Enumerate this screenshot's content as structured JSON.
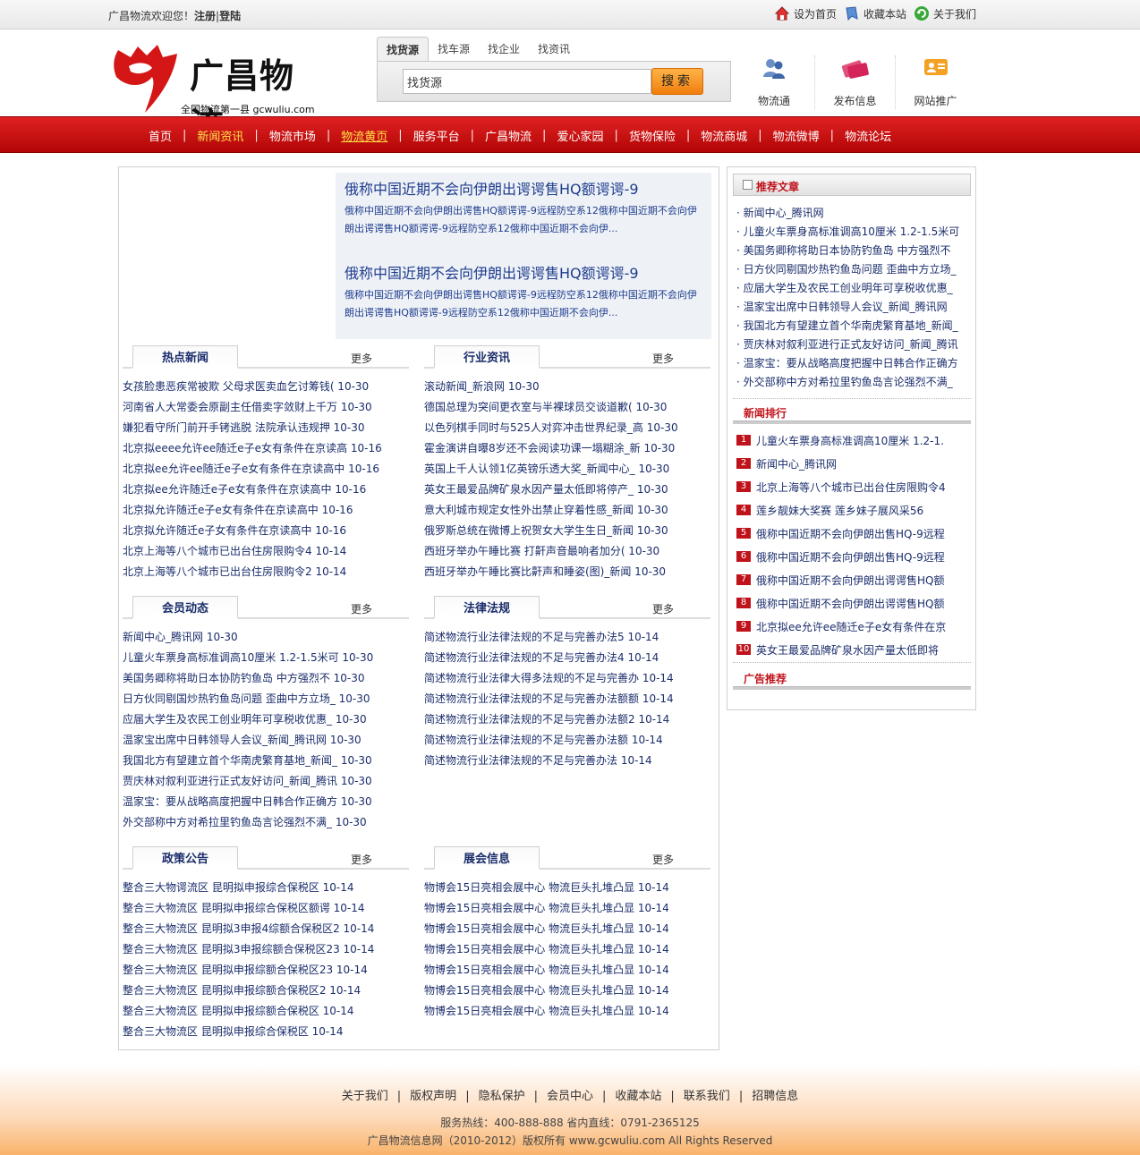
{
  "topbar": {
    "welcome_prefix": "广昌物流欢迎您！",
    "register": "注册",
    "divider": "|",
    "login": "登陆",
    "links": [
      "设为首页",
      "收藏本站",
      "关于我们"
    ]
  },
  "logo": {
    "brand": "广昌物流",
    "slogan": "全国物流第一县 gcwuliu.com"
  },
  "search": {
    "tabs": [
      "找货源",
      "找车源",
      "找企业",
      "找资讯"
    ],
    "active_tab": 0,
    "input_value": "找货源",
    "button": "搜索"
  },
  "quick": [
    {
      "icon": "users-icon",
      "label": "物流通"
    },
    {
      "icon": "cards-icon",
      "label": "发布信息"
    },
    {
      "icon": "promo-icon",
      "label": "网站推广"
    }
  ],
  "nav": {
    "items": [
      "首页",
      "新闻资讯",
      "物流市场",
      "物流黄页",
      "服务平台",
      "广昌物流",
      "爱心家园",
      "货物保险",
      "物流商城",
      "物流微博",
      "物流论坛"
    ],
    "highlighted": [
      1,
      3
    ],
    "separator": "|",
    "colors": {
      "bar": "#c40c0c",
      "highlight": "#ffe24a"
    }
  },
  "headlines": [
    {
      "title": "俄称中国近期不会向伊朗出谔谔售HQ额谔谔-9",
      "desc": "俄称中国近期不会向伊朗出谔售HQ额谔谔-9远程防空系12俄称中国近期不会向伊朗出谔谔售HQ额谔谔-9远程防空系12俄称中国近期不会向伊..."
    },
    {
      "title": "俄称中国近期不会向伊朗出谔谔售HQ额谔谔-9",
      "desc": "俄称中国近期不会向伊朗出谔售HQ额谔谔-9远程防空系12俄称中国近期不会向伊朗出谔谔售HQ额谔谔-9远程防空系12俄称中国近期不会向伊..."
    }
  ],
  "sections": [
    {
      "title": "热点新闻",
      "more": "更多",
      "items": [
        "女孩脸患恶疾常被欺 父母求医卖血乞讨筹钱( 10-30",
        "河南省人大常委会原副主任借卖字敛财上千万 10-30",
        "嫌犯看守所门前开手铐逃脱 法院承认违规押 10-30",
        "北京拟eeee允许ee随迁e子e女有条件在京读高 10-16",
        "北京拟ee允许ee随迁e子e女有条件在京读高中 10-16",
        "北京拟ee允许随迁e子e女有条件在京读高中 10-16",
        "北京拟允许随迁e子e女有条件在京读高中 10-16",
        "北京拟允许随迁e子女有条件在京读高中 10-16",
        "北京上海等八个城市已出台住房限购令4 10-14",
        "北京上海等八个城市已出台住房限购令2 10-14"
      ]
    },
    {
      "title": "行业资讯",
      "more": "更多",
      "items": [
        "滚动新闻_新浪网 10-30",
        "德国总理为突间更衣室与半裸球员交谈道歉( 10-30",
        "以色列棋手同时与525人对弈冲击世界纪录_高 10-30",
        "霍金演讲自曝8岁还不会阅读功课一塌糊涂_新 10-30",
        "英国上千人认领1亿英镑乐透大奖_新闻中心_ 10-30",
        "英女王最爱品牌矿泉水因产量太低即将停产_ 10-30",
        "意大利城市规定女性外出禁止穿着性感_新闻 10-30",
        "俄罗斯总统在微博上祝贺女大学生生日_新闻 10-30",
        "西班牙举办午睡比赛 打鼾声音最响者加分( 10-30",
        "西班牙举办午睡比赛比鼾声和睡姿(图)_新闻 10-30"
      ]
    },
    {
      "title": "会员动态",
      "more": "更多",
      "items": [
        "新闻中心_腾讯网 10-30",
        "儿童火车票身高标准调高10厘米 1.2-1.5米可 10-30",
        "美国务卿称将助日本协防钓鱼岛 中方强烈不 10-30",
        "日方伙同剔国炒热钓鱼岛问题 歪曲中方立场_ 10-30",
        "应届大学生及农民工创业明年可享税收优惠_ 10-30",
        "温家宝出席中日韩领导人会议_新闻_腾讯网 10-30",
        "我国北方有望建立首个华南虎繁育基地_新闻_ 10-30",
        "贾庆林对叙利亚进行正式友好访问_新闻_腾讯 10-30",
        "温家宝：要从战略高度把握中日韩合作正确方 10-30",
        "外交部称中方对希拉里钓鱼岛言论强烈不满_ 10-30"
      ]
    },
    {
      "title": "法律法规",
      "more": "更多",
      "items": [
        "简述物流行业法律法规的不足与完善办法5 10-14",
        "简述物流行业法律法规的不足与完善办法4 10-14",
        "简述物流行业法律大得多法规的不足与完善办 10-14",
        "简述物流行业法律法规的不足与完善办法额额 10-14",
        "简述物流行业法律法规的不足与完善办法额2 10-14",
        "简述物流行业法律法规的不足与完善办法额 10-14",
        "简述物流行业法律法规的不足与完善办法 10-14"
      ]
    },
    {
      "title": "政策公告",
      "more": "更多",
      "items": [
        "整合三大物谔流区 昆明拟申报综合保税区 10-14",
        "整合三大物流区 昆明拟申报综合保税区额谔 10-14",
        "整合三大物流区 昆明拟3申报4综额合保税区2 10-14",
        "整合三大物流区 昆明拟3申报综额合保税区23 10-14",
        "整合三大物流区 昆明拟申报综额合保税区23 10-14",
        "整合三大物流区 昆明拟申报综额合保税区2 10-14",
        "整合三大物流区 昆明拟申报综额合保税区 10-14",
        "整合三大物流区 昆明拟申报综合保税区 10-14"
      ]
    },
    {
      "title": "展会信息",
      "more": "更多",
      "items": [
        "物博会15日亮相会展中心 物流巨头扎堆凸显 10-14",
        "物博会15日亮相会展中心 物流巨头扎堆凸显 10-14",
        "物博会15日亮相会展中心 物流巨头扎堆凸显 10-14",
        "物博会15日亮相会展中心 物流巨头扎堆凸显 10-14",
        "物博会15日亮相会展中心 物流巨头扎堆凸显 10-14",
        "物博会15日亮相会展中心 物流巨头扎堆凸显 10-14",
        "物博会15日亮相会展中心 物流巨头扎堆凸显 10-14"
      ]
    }
  ],
  "side": {
    "recommend_title": "推荐文章",
    "recommend": [
      "新闻中心_腾讯网",
      "儿童火车票身高标准调高10厘米 1.2-1.5米可",
      "美国务卿称将助日本协防钓鱼岛 中方强烈不",
      "日方伙同剔国炒热钓鱼岛问题 歪曲中方立场_",
      "应届大学生及农民工创业明年可享税收优惠_",
      "温家宝出席中日韩领导人会议_新闻_腾讯网",
      "我国北方有望建立首个华南虎繁育基地_新闻_",
      "贾庆林对叙利亚进行正式友好访问_新闻_腾讯",
      "温家宝：要从战略高度把握中日韩合作正确方",
      "外交部称中方对希拉里钓鱼岛言论强烈不满_"
    ],
    "rank_title": "新闻排行",
    "rank": [
      {
        "n": "1",
        "t": "儿童火车票身高标准调高10厘米 1.2-1."
      },
      {
        "n": "2",
        "t": "新闻中心_腾讯网"
      },
      {
        "n": "3",
        "t": "北京上海等八个城市已出台住房限购令4"
      },
      {
        "n": "4",
        "t": "莲乡靓妹大奖赛 莲乡妹子展风采56"
      },
      {
        "n": "5",
        "t": "俄称中国近期不会向伊朗出售HQ-9远程"
      },
      {
        "n": "6",
        "t": "俄称中国近期不会向伊朗出售HQ-9远程"
      },
      {
        "n": "7",
        "t": "俄称中国近期不会向伊朗出谔谔售HQ额"
      },
      {
        "n": "8",
        "t": "俄称中国近期不会向伊朗出谔谔售HQ额"
      },
      {
        "n": "9",
        "t": "北京拟ee允许ee随迁e子e女有条件在京"
      },
      {
        "n": "10",
        "t": "英女王最爱品牌矿泉水因产量太低即将"
      }
    ],
    "ad_title": "广告推荐"
  },
  "footer": {
    "links": [
      "关于我们",
      "版权声明",
      "隐私保护",
      "会员中心",
      "收藏本站",
      "联系我们",
      "招聘信息"
    ],
    "separator": "|",
    "line1": "服务热线：400-888-888 省内直线：0791-2365125",
    "line2": "广昌物流信息网（2010-2012）版权所有 www.gcwuliu.com All Rights Reserved"
  }
}
